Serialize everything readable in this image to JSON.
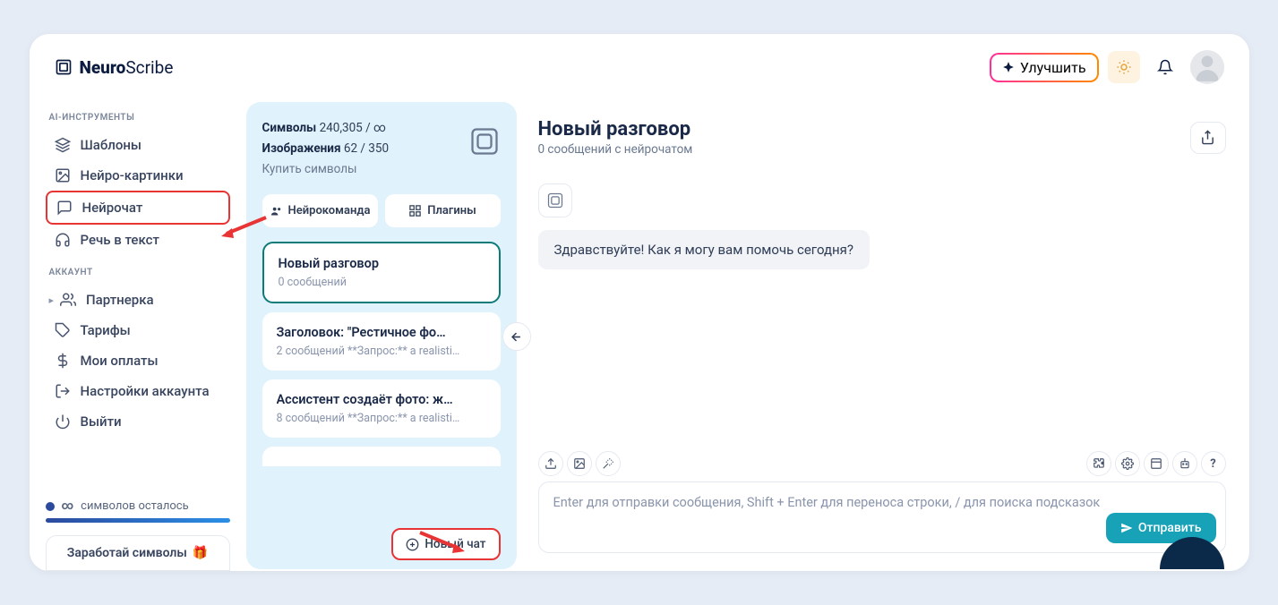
{
  "brand": {
    "name_bold": "Neuro",
    "name_light": "Scribe"
  },
  "header": {
    "upgrade": "Улучшить"
  },
  "sidebar": {
    "section1": "AI-ИНСТРУМЕНТЫ",
    "section2": "АККАУНТ",
    "items": {
      "templates": "Шаблоны",
      "images": "Нейро-картинки",
      "chat": "Нейрочат",
      "speech": "Речь в текст",
      "partner": "Партнерка",
      "pricing": "Тарифы",
      "payments": "Мои оплаты",
      "settings": "Настройки аккаунта",
      "logout": "Выйти"
    },
    "status_prefix": "∞",
    "status": "символов осталось",
    "earn": "Заработай символы"
  },
  "chat_sidebar": {
    "symbols_label": "Символы",
    "symbols_value": "240,305 / ∞",
    "images_label": "Изображения",
    "images_value": "62 / 350",
    "buy": "Купить символы",
    "tab1": "Нейрокоманда",
    "tab2": "Плагины",
    "conversations": [
      {
        "title": "Новый разговор",
        "meta": "0 сообщений"
      },
      {
        "title": "Заголовок: \"Рестичное фо…",
        "meta": "2 сообщений   **Запрос:** a realisti…"
      },
      {
        "title": "Ассистент создаёт фото: ж…",
        "meta": "8 сообщений   **Запрос:** a realisti…"
      }
    ],
    "new_chat": "Новый чат"
  },
  "main": {
    "title": "Новый разговор",
    "subtitle": "0 сообщений с нейрочатом",
    "greeting": "Здравствуйте! Как я могу вам помочь сегодня?",
    "placeholder": "Enter для отправки сообщения, Shift + Enter для переноса строки, / для поиска подсказок",
    "send": "Отправить"
  }
}
